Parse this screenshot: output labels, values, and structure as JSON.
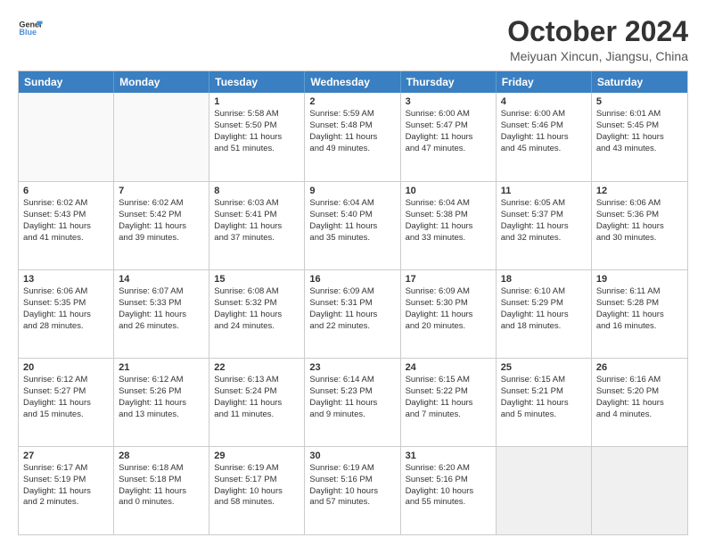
{
  "header": {
    "logo_line1": "General",
    "logo_line2": "Blue",
    "month": "October 2024",
    "location": "Meiyuan Xincun, Jiangsu, China"
  },
  "weekdays": [
    "Sunday",
    "Monday",
    "Tuesday",
    "Wednesday",
    "Thursday",
    "Friday",
    "Saturday"
  ],
  "rows": [
    [
      {
        "day": "",
        "lines": [],
        "empty": true
      },
      {
        "day": "",
        "lines": [],
        "empty": true
      },
      {
        "day": "1",
        "lines": [
          "Sunrise: 5:58 AM",
          "Sunset: 5:50 PM",
          "Daylight: 11 hours",
          "and 51 minutes."
        ]
      },
      {
        "day": "2",
        "lines": [
          "Sunrise: 5:59 AM",
          "Sunset: 5:48 PM",
          "Daylight: 11 hours",
          "and 49 minutes."
        ]
      },
      {
        "day": "3",
        "lines": [
          "Sunrise: 6:00 AM",
          "Sunset: 5:47 PM",
          "Daylight: 11 hours",
          "and 47 minutes."
        ]
      },
      {
        "day": "4",
        "lines": [
          "Sunrise: 6:00 AM",
          "Sunset: 5:46 PM",
          "Daylight: 11 hours",
          "and 45 minutes."
        ]
      },
      {
        "day": "5",
        "lines": [
          "Sunrise: 6:01 AM",
          "Sunset: 5:45 PM",
          "Daylight: 11 hours",
          "and 43 minutes."
        ]
      }
    ],
    [
      {
        "day": "6",
        "lines": [
          "Sunrise: 6:02 AM",
          "Sunset: 5:43 PM",
          "Daylight: 11 hours",
          "and 41 minutes."
        ]
      },
      {
        "day": "7",
        "lines": [
          "Sunrise: 6:02 AM",
          "Sunset: 5:42 PM",
          "Daylight: 11 hours",
          "and 39 minutes."
        ]
      },
      {
        "day": "8",
        "lines": [
          "Sunrise: 6:03 AM",
          "Sunset: 5:41 PM",
          "Daylight: 11 hours",
          "and 37 minutes."
        ]
      },
      {
        "day": "9",
        "lines": [
          "Sunrise: 6:04 AM",
          "Sunset: 5:40 PM",
          "Daylight: 11 hours",
          "and 35 minutes."
        ]
      },
      {
        "day": "10",
        "lines": [
          "Sunrise: 6:04 AM",
          "Sunset: 5:38 PM",
          "Daylight: 11 hours",
          "and 33 minutes."
        ]
      },
      {
        "day": "11",
        "lines": [
          "Sunrise: 6:05 AM",
          "Sunset: 5:37 PM",
          "Daylight: 11 hours",
          "and 32 minutes."
        ]
      },
      {
        "day": "12",
        "lines": [
          "Sunrise: 6:06 AM",
          "Sunset: 5:36 PM",
          "Daylight: 11 hours",
          "and 30 minutes."
        ]
      }
    ],
    [
      {
        "day": "13",
        "lines": [
          "Sunrise: 6:06 AM",
          "Sunset: 5:35 PM",
          "Daylight: 11 hours",
          "and 28 minutes."
        ]
      },
      {
        "day": "14",
        "lines": [
          "Sunrise: 6:07 AM",
          "Sunset: 5:33 PM",
          "Daylight: 11 hours",
          "and 26 minutes."
        ]
      },
      {
        "day": "15",
        "lines": [
          "Sunrise: 6:08 AM",
          "Sunset: 5:32 PM",
          "Daylight: 11 hours",
          "and 24 minutes."
        ]
      },
      {
        "day": "16",
        "lines": [
          "Sunrise: 6:09 AM",
          "Sunset: 5:31 PM",
          "Daylight: 11 hours",
          "and 22 minutes."
        ]
      },
      {
        "day": "17",
        "lines": [
          "Sunrise: 6:09 AM",
          "Sunset: 5:30 PM",
          "Daylight: 11 hours",
          "and 20 minutes."
        ]
      },
      {
        "day": "18",
        "lines": [
          "Sunrise: 6:10 AM",
          "Sunset: 5:29 PM",
          "Daylight: 11 hours",
          "and 18 minutes."
        ]
      },
      {
        "day": "19",
        "lines": [
          "Sunrise: 6:11 AM",
          "Sunset: 5:28 PM",
          "Daylight: 11 hours",
          "and 16 minutes."
        ]
      }
    ],
    [
      {
        "day": "20",
        "lines": [
          "Sunrise: 6:12 AM",
          "Sunset: 5:27 PM",
          "Daylight: 11 hours",
          "and 15 minutes."
        ]
      },
      {
        "day": "21",
        "lines": [
          "Sunrise: 6:12 AM",
          "Sunset: 5:26 PM",
          "Daylight: 11 hours",
          "and 13 minutes."
        ]
      },
      {
        "day": "22",
        "lines": [
          "Sunrise: 6:13 AM",
          "Sunset: 5:24 PM",
          "Daylight: 11 hours",
          "and 11 minutes."
        ]
      },
      {
        "day": "23",
        "lines": [
          "Sunrise: 6:14 AM",
          "Sunset: 5:23 PM",
          "Daylight: 11 hours",
          "and 9 minutes."
        ]
      },
      {
        "day": "24",
        "lines": [
          "Sunrise: 6:15 AM",
          "Sunset: 5:22 PM",
          "Daylight: 11 hours",
          "and 7 minutes."
        ]
      },
      {
        "day": "25",
        "lines": [
          "Sunrise: 6:15 AM",
          "Sunset: 5:21 PM",
          "Daylight: 11 hours",
          "and 5 minutes."
        ]
      },
      {
        "day": "26",
        "lines": [
          "Sunrise: 6:16 AM",
          "Sunset: 5:20 PM",
          "Daylight: 11 hours",
          "and 4 minutes."
        ]
      }
    ],
    [
      {
        "day": "27",
        "lines": [
          "Sunrise: 6:17 AM",
          "Sunset: 5:19 PM",
          "Daylight: 11 hours",
          "and 2 minutes."
        ]
      },
      {
        "day": "28",
        "lines": [
          "Sunrise: 6:18 AM",
          "Sunset: 5:18 PM",
          "Daylight: 11 hours",
          "and 0 minutes."
        ]
      },
      {
        "day": "29",
        "lines": [
          "Sunrise: 6:19 AM",
          "Sunset: 5:17 PM",
          "Daylight: 10 hours",
          "and 58 minutes."
        ]
      },
      {
        "day": "30",
        "lines": [
          "Sunrise: 6:19 AM",
          "Sunset: 5:16 PM",
          "Daylight: 10 hours",
          "and 57 minutes."
        ]
      },
      {
        "day": "31",
        "lines": [
          "Sunrise: 6:20 AM",
          "Sunset: 5:16 PM",
          "Daylight: 10 hours",
          "and 55 minutes."
        ]
      },
      {
        "day": "",
        "lines": [],
        "empty": true,
        "shaded": true
      },
      {
        "day": "",
        "lines": [],
        "empty": true,
        "shaded": true
      }
    ]
  ]
}
